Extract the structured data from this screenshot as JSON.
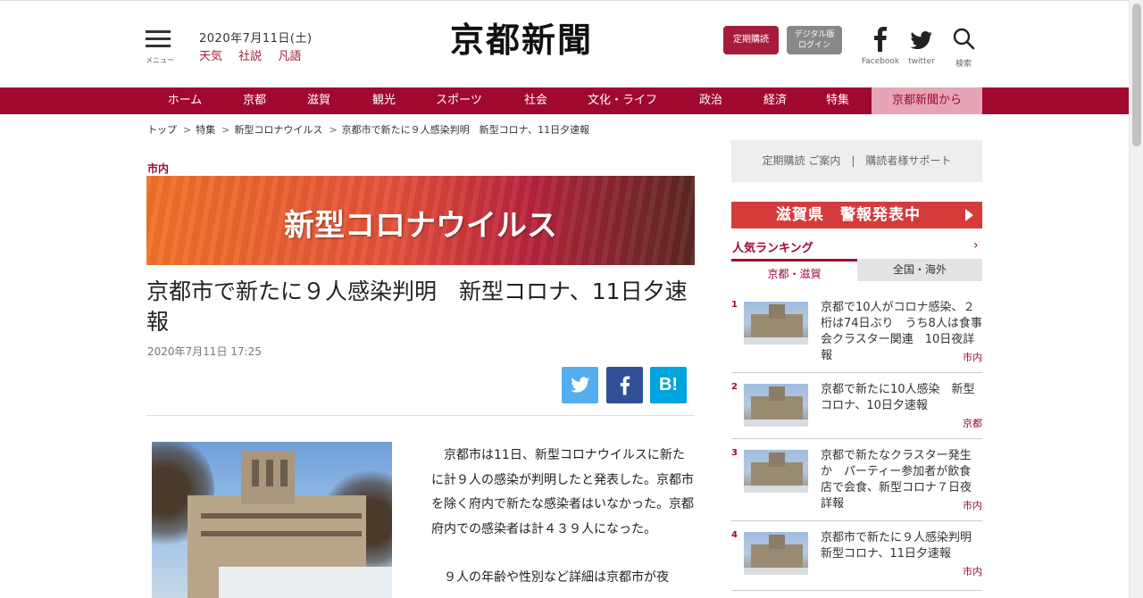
{
  "header": {
    "menu_label": "メニュー",
    "date": "2020年7月11日(土)",
    "sublinks": [
      "天気",
      "社説",
      "凡語"
    ],
    "logo_text": "京都新聞",
    "subscribe_label": "定期購読",
    "digital_label_1": "デジタル版",
    "digital_label_2": "ログイン",
    "facebook_label": "Facebook",
    "twitter_label": "twitter",
    "search_label": "検索"
  },
  "nav": {
    "items": [
      "ホーム",
      "京都",
      "滋賀",
      "観光",
      "スポーツ",
      "社会",
      "文化・ライフ",
      "政治",
      "経済",
      "特集",
      "京都新聞から"
    ]
  },
  "breadcrumb": [
    "トップ",
    "特集",
    "新型コロナウイルス",
    "京都市で新たに９人感染判明　新型コロナ、11日夕速報"
  ],
  "article": {
    "category": "市内",
    "banner_text": "新型コロナウイルス",
    "headline": "京都市で新たに９人感染判明　新型コロナ、11日夕速報",
    "date": "2020年7月11日 17:25",
    "share_hatena": "B!",
    "paragraphs": [
      "京都市は11日、新型コロナウイルスに新たに計９人の感染が判明したと発表した。京都市を除く府内で新たな感染者はいなかった。京都府内での感染者は計４３９人になった。",
      "９人の年齢や性別など詳細は京都市が夜"
    ]
  },
  "sidebar": {
    "support_links": [
      "定期購読 ご案内",
      "購読者様サポート"
    ],
    "support_sep": "|",
    "alert_text": "滋賀県　警報発表中",
    "ranking_title": "人気ランキング",
    "ranking_more": "›",
    "tabs": [
      "京都・滋賀",
      "全国・海外"
    ],
    "ranking": [
      {
        "num": "1",
        "title": "京都で10人がコロナ感染、２桁は74日ぶり　うち8人は食事会クラスター関連　10日夜詳報",
        "category": "市内"
      },
      {
        "num": "2",
        "title": "京都で新たに10人感染　新型コロナ、10日夕速報",
        "category": "京都"
      },
      {
        "num": "3",
        "title": "京都で新たなクラスター発生か　パーティー参加者が飲食店で会食、新型コロナ７日夜詳報",
        "category": "市内"
      },
      {
        "num": "4",
        "title": "京都市で新たに９人感染判明　新型コロナ、11日夕速報",
        "category": "市内"
      }
    ]
  },
  "colors": {
    "brand": "#a0082f",
    "alert": "#d43c3c",
    "twitter": "#55acee",
    "facebook": "#315096",
    "hatena": "#00a4de"
  }
}
